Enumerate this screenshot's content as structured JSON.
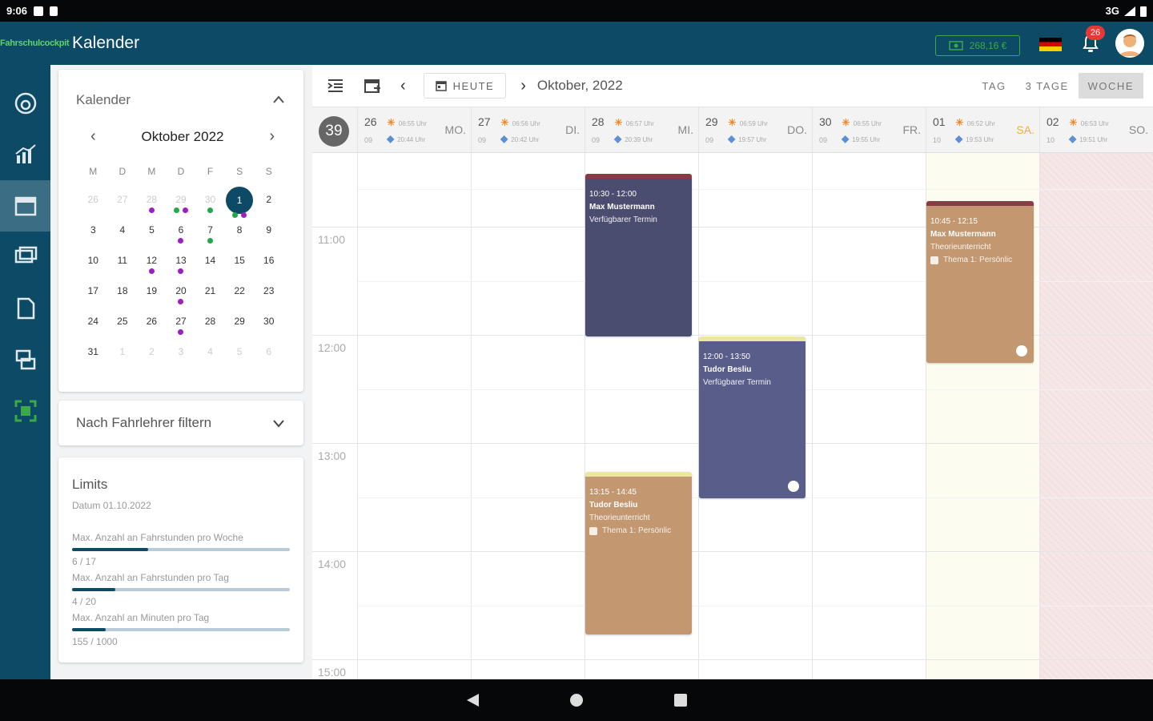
{
  "status": {
    "time": "9:06",
    "network": "3G"
  },
  "header": {
    "logo": "Fahrschulcockpit",
    "title": "Kalender",
    "wallet": "268,16 €",
    "notifications": "26"
  },
  "sidebar": {
    "items": [
      "dashboard",
      "statistics",
      "calendar",
      "chat",
      "documents",
      "lessons",
      "qr"
    ]
  },
  "mini_calendar": {
    "heading": "Kalender",
    "month_label": "Oktober 2022",
    "weekdays": [
      "M",
      "D",
      "M",
      "D",
      "F",
      "S",
      "S"
    ],
    "weeks": [
      [
        "26",
        "27",
        "28",
        "29",
        "30",
        "1",
        "2"
      ],
      [
        "3",
        "4",
        "5",
        "6",
        "7",
        "8",
        "9"
      ],
      [
        "10",
        "11",
        "12",
        "13",
        "14",
        "15",
        "16"
      ],
      [
        "17",
        "18",
        "19",
        "20",
        "21",
        "22",
        "23"
      ],
      [
        "24",
        "25",
        "26",
        "27",
        "28",
        "29",
        "30"
      ],
      [
        "31",
        "1",
        "2",
        "3",
        "4",
        "5",
        "6"
      ]
    ]
  },
  "filter": {
    "label": "Nach Fahrlehrer filtern"
  },
  "limits": {
    "heading": "Limits",
    "date": "Datum 01.10.2022",
    "items": [
      {
        "label": "Max. Anzahl an Fahrstunden pro Woche",
        "value": "6 / 17",
        "progress": 0.35
      },
      {
        "label": "Max. Anzahl an Fahrstunden pro Tag",
        "value": "4 / 20",
        "progress": 0.2
      },
      {
        "label": "Max. Anzahl an Minuten pro Tag",
        "value": "155 / 1000",
        "progress": 0.155
      }
    ]
  },
  "toolbar": {
    "today": "HEUTE",
    "month": "Oktober, 2022",
    "views": [
      "TAG",
      "3 TAGE",
      "WOCHE"
    ],
    "active_view": "WOCHE"
  },
  "week": {
    "number": "39",
    "days": [
      {
        "num": "26",
        "sub": "09",
        "rise": "06:55 Uhr",
        "set": "20:44 Uhr",
        "name": "MO."
      },
      {
        "num": "27",
        "sub": "09",
        "rise": "06:56 Uhr",
        "set": "20:42 Uhr",
        "name": "DI."
      },
      {
        "num": "28",
        "sub": "09",
        "rise": "06:57 Uhr",
        "set": "20:39 Uhr",
        "name": "MI."
      },
      {
        "num": "29",
        "sub": "09",
        "rise": "06:59 Uhr",
        "set": "19:57 Uhr",
        "name": "DO."
      },
      {
        "num": "30",
        "sub": "09",
        "rise": "06:55 Uhr",
        "set": "19:55 Uhr",
        "name": "FR."
      },
      {
        "num": "01",
        "sub": "10",
        "rise": "06:52 Uhr",
        "set": "19:53 Uhr",
        "name": "SA."
      },
      {
        "num": "02",
        "sub": "10",
        "rise": "06:53 Uhr",
        "set": "19:51 Uhr",
        "name": "SO."
      }
    ],
    "hours": [
      "11:00",
      "12:00",
      "13:00",
      "14:00",
      "15:00"
    ]
  },
  "events": [
    {
      "time": "10:30 - 12:00",
      "name": "Max Mustermann",
      "kind": "Verfügbarer Termin",
      "tag": "",
      "color": "#4b4d70"
    },
    {
      "time": "12:00 - 13:50",
      "name": "Tudor Besliu",
      "kind": "Verfügbarer Termin",
      "tag": "",
      "color": "#595d8a"
    },
    {
      "time": "13:15 - 14:45",
      "name": "Tudor Besliu",
      "kind": "Theorieunterricht",
      "tag": "Thema 1: Persönlic",
      "color": "#c39770"
    },
    {
      "time": "10:45 - 12:15",
      "name": "Max Mustermann",
      "kind": "Theorieunterricht",
      "tag": "Thema 1: Persönlic",
      "color": "#c39770"
    }
  ],
  "colors": {
    "primary": "#0d4a66",
    "green": "#3ba84a",
    "accent_sat": "#f4b31a"
  }
}
